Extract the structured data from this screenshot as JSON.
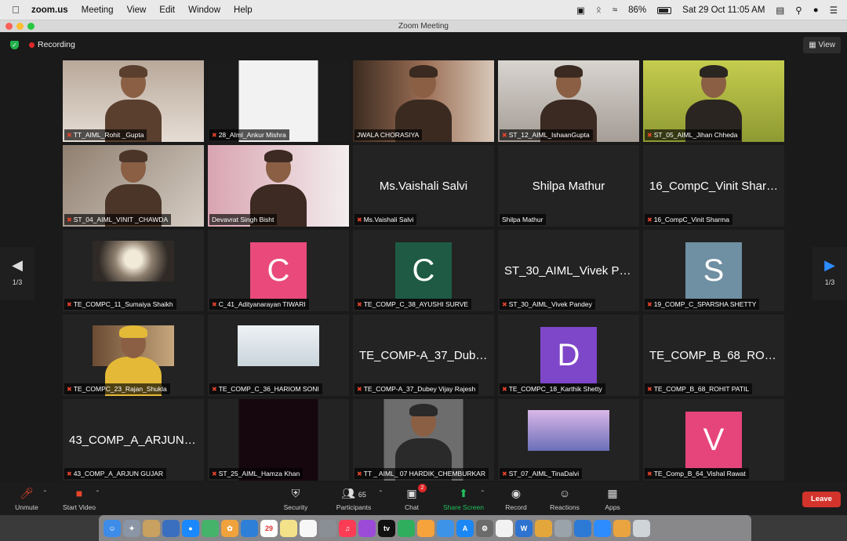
{
  "menubar": {
    "apple": "",
    "items": [
      "zoom.us",
      "Meeting",
      "View",
      "Edit",
      "Window",
      "Help"
    ],
    "battery": "86%",
    "datetime": "Sat 29 Oct  11:05 AM"
  },
  "window": {
    "title": "Zoom Meeting"
  },
  "topbar": {
    "recording": "Recording",
    "view": "View"
  },
  "pager": {
    "left_page": "1/3",
    "right_page": "1/3"
  },
  "tiles": [
    {
      "label": "TT_AIML_Rohit _Gupta",
      "display": ""
    },
    {
      "label": "28_AIml_Ankur Mishra",
      "display": ""
    },
    {
      "label": "JWALA CHORASIYA",
      "display": ""
    },
    {
      "label": "ST_12_AIML_IshaanGupta",
      "display": ""
    },
    {
      "label": "ST_05_AIML_Jihan Chheda",
      "display": ""
    },
    {
      "label": "ST_04_AIML_VINIT _CHAWDA",
      "display": ""
    },
    {
      "label": "Devavrat Singh Bisht",
      "display": ""
    },
    {
      "label": "Ms.Vaishali Salvi",
      "display": "Ms.Vaishali Salvi"
    },
    {
      "label": "Shilpa Mathur",
      "display": "Shilpa Mathur"
    },
    {
      "label": "16_CompC_Vinit Sharma",
      "display": "16_CompC_Vinit Sharma"
    },
    {
      "label": "TE_COMPC_11_Sumaiya Shaikh",
      "display": ""
    },
    {
      "label": "C_41_Adityanarayan TIWARI",
      "display": "C"
    },
    {
      "label": "TE_COMP_C_38_AYUSHI SURVE",
      "display": "C"
    },
    {
      "label": "ST_30_AIML_Vivek Pandey",
      "display": "ST_30_AIML_Vivek Pan..."
    },
    {
      "label": "19_COMP_C_SPARSHA SHETTY",
      "display": "S"
    },
    {
      "label": "TE_COMPC_23_Rajan_Shukla",
      "display": ""
    },
    {
      "label": "TE_COMP_C_36_HARIOM SONI",
      "display": ""
    },
    {
      "label": "TE_COMP-A_37_Dubey Vijay Rajesh",
      "display": "TE_COMP-A_37_Dube..."
    },
    {
      "label": "TE_COMPC_18_Karthik Shetty",
      "display": "D"
    },
    {
      "label": "TE_COMP_B_68_ROHIT PATIL",
      "display": "TE_COMP_B_68_ROHI..."
    },
    {
      "label": "43_COMP_A_ARJUN GUJAR",
      "display": "43_COMP_A_ARJUN G..."
    },
    {
      "label": "ST_25_AIML_Hamza Khan",
      "display": ""
    },
    {
      "label": "TT _ AIML_ 07 HARDIK_CHEMBURKAR",
      "display": ""
    },
    {
      "label": "ST_07_AIML_TinaDalvi",
      "display": ""
    },
    {
      "label": "TE_Comp_B_64_Vishal Rawat",
      "display": "V"
    }
  ],
  "avatar_colors": {
    "C_41_Adityanarayan TIWARI": "#e94a7b",
    "TE_COMP_C_38_AYUSHI SURVE": "#1f5a45",
    "19_COMP_C_SPARSHA SHETTY": "#6f8fa2",
    "TE_COMPC_18_Karthik Shetty": "#7e46c9",
    "TE_Comp_B_64_Vishal Rawat": "#e6457b"
  },
  "toolbar": {
    "unmute": "Unmute",
    "start_video": "Start Video",
    "security": "Security",
    "participants": "Participants",
    "participants_count": "65",
    "chat": "Chat",
    "chat_badge": "2",
    "share_screen": "Share Screen",
    "record": "Record",
    "reactions": "Reactions",
    "apps": "Apps",
    "leave": "Leave"
  },
  "dock": {
    "calendar_day": "29",
    "tv_label": "tv"
  },
  "colors": {
    "accent_active": "#c6e24a",
    "share_green": "#22c15e",
    "leave_red": "#d2342c"
  }
}
